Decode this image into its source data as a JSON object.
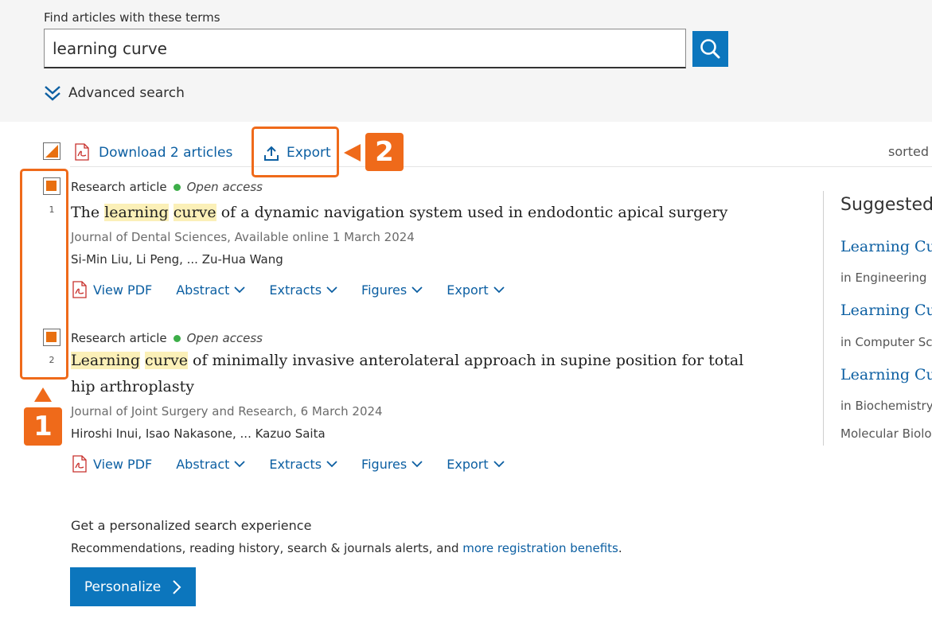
{
  "search": {
    "label": "Find articles with these terms",
    "value": "learning curve",
    "advanced_label": "Advanced search"
  },
  "toolbar": {
    "download_label": "Download 2 articles",
    "export_label": "Export",
    "sorted_label": "sorted"
  },
  "callouts": {
    "badge1": "1",
    "badge2": "2"
  },
  "results": [
    {
      "number": "1",
      "type": "Research article",
      "access": "Open access",
      "title_parts": [
        "The ",
        "learning",
        " ",
        "curve",
        " of a dynamic navigation system used in endodontic apical surgery"
      ],
      "journal": "Journal of Dental Sciences, Available online 1 March 2024",
      "authors": "Si-Min Liu, Li Peng, ... Zu-Hua Wang",
      "actions": [
        "View PDF",
        "Abstract",
        "Extracts",
        "Figures",
        "Export"
      ]
    },
    {
      "number": "2",
      "type": "Research article",
      "access": "Open access",
      "title_parts": [
        "Learning",
        " ",
        "curve",
        " of minimally invasive anterolateral approach in supine position for total hip arthroplasty"
      ],
      "journal": "Journal of Joint Surgery and Research, 6 March 2024",
      "authors": "Hiroshi Inui, Isao Nakasone, ... Kazuo Saita",
      "actions": [
        "View PDF",
        "Abstract",
        "Extracts",
        "Figures",
        "Export"
      ]
    }
  ],
  "suggested": {
    "heading": "Suggested",
    "items": [
      {
        "title": "Learning Cur",
        "category": "in Engineering"
      },
      {
        "title": "Learning Cur",
        "category": "in Computer Sci"
      },
      {
        "title": "Learning Cur",
        "category": "in Biochemistry,",
        "category_line2": "Molecular Biolo"
      }
    ]
  },
  "personalize": {
    "heading": "Get a personalized search experience",
    "text": "Recommendations, reading history, search & journals alerts, and ",
    "link": "more registration benefits",
    "text_end": ".",
    "button_label": "Personalize"
  },
  "colors": {
    "accent_blue": "#0c76bd",
    "link_blue": "#0c5fa2",
    "callout_orange": "#ef6a1a",
    "highlight": "#fbf0b8",
    "open_access_green": "#3dae49"
  }
}
